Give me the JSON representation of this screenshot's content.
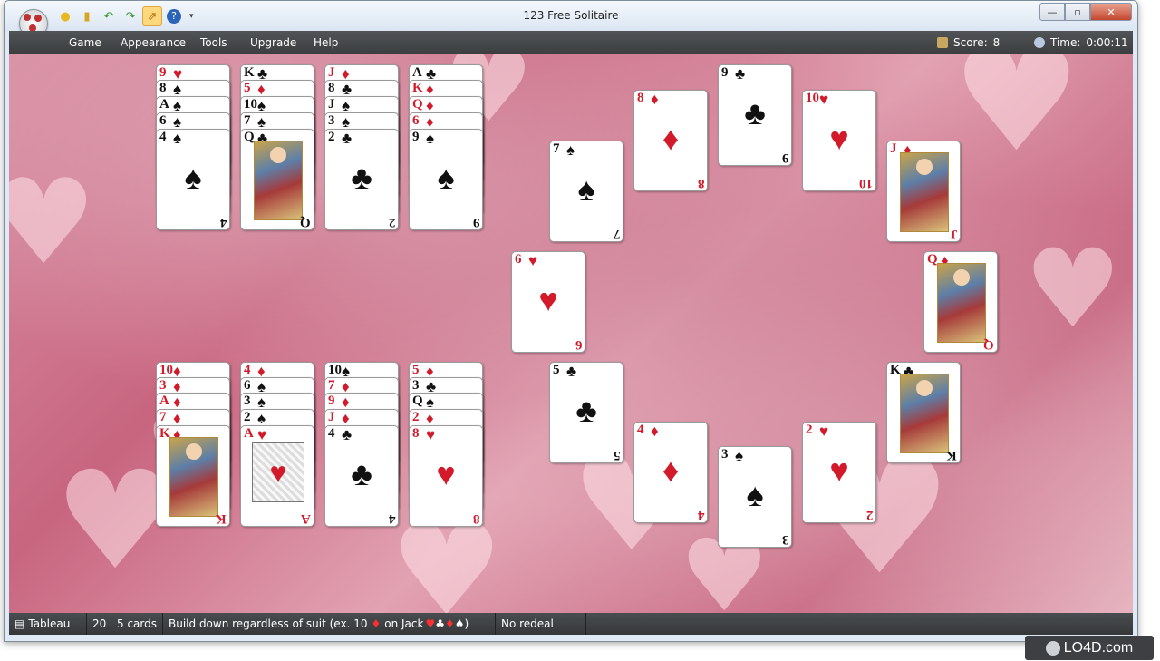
{
  "window": {
    "title": "123 Free Solitaire"
  },
  "menu": [
    "Game",
    "Appearance",
    "Tools",
    "Upgrade",
    "Help"
  ],
  "score": {
    "label": "Score:",
    "value": "8"
  },
  "time": {
    "label": "Time:",
    "value": "0:00:11"
  },
  "statusbar": {
    "mode": "Tableau",
    "count": "20",
    "cards": "5 cards",
    "hint_prefix": "Build down regardless of suit (ex. 10",
    "hint_mid": "on Jack",
    "hint_suffix": ")",
    "redeal": "No redeal"
  },
  "watermark": "LO4D.com",
  "cards": [
    {
      "rank": "9",
      "suit": "♥",
      "color": "red"
    },
    {
      "rank": "8",
      "suit": "♠",
      "color": "black"
    },
    {
      "rank": "A",
      "suit": "♠",
      "color": "black"
    },
    {
      "rank": "6",
      "suit": "♠",
      "color": "black"
    },
    {
      "rank": "4",
      "suit": "♠",
      "color": "black"
    },
    {
      "rank": "K",
      "suit": "♣",
      "color": "black"
    },
    {
      "rank": "5",
      "suit": "♦",
      "color": "red"
    },
    {
      "rank": "10",
      "suit": "♠",
      "color": "black"
    },
    {
      "rank": "7",
      "suit": "♠",
      "color": "black"
    },
    {
      "rank": "Q",
      "suit": "♣",
      "color": "black"
    },
    {
      "rank": "J",
      "suit": "♦",
      "color": "red"
    },
    {
      "rank": "8",
      "suit": "♣",
      "color": "black"
    },
    {
      "rank": "J",
      "suit": "♠",
      "color": "black"
    },
    {
      "rank": "3",
      "suit": "♠",
      "color": "black"
    },
    {
      "rank": "2",
      "suit": "♣",
      "color": "black"
    },
    {
      "rank": "A",
      "suit": "♣",
      "color": "black"
    },
    {
      "rank": "K",
      "suit": "♦",
      "color": "red"
    },
    {
      "rank": "Q",
      "suit": "♦",
      "color": "red"
    },
    {
      "rank": "6",
      "suit": "♦",
      "color": "red"
    },
    {
      "rank": "9",
      "suit": "♠",
      "color": "black"
    },
    {
      "rank": "10",
      "suit": "♦",
      "color": "red"
    },
    {
      "rank": "3",
      "suit": "♦",
      "color": "red"
    },
    {
      "rank": "A",
      "suit": "♦",
      "color": "red"
    },
    {
      "rank": "7",
      "suit": "♦",
      "color": "red"
    },
    {
      "rank": "K",
      "suit": "♦",
      "color": "red"
    },
    {
      "rank": "4",
      "suit": "♦",
      "color": "red"
    },
    {
      "rank": "6",
      "suit": "♠",
      "color": "black"
    },
    {
      "rank": "3",
      "suit": "♠",
      "color": "black"
    },
    {
      "rank": "2",
      "suit": "♠",
      "color": "black"
    },
    {
      "rank": "A",
      "suit": "♥",
      "color": "red"
    },
    {
      "rank": "10",
      "suit": "♠",
      "color": "black"
    },
    {
      "rank": "7",
      "suit": "♦",
      "color": "red"
    },
    {
      "rank": "9",
      "suit": "♦",
      "color": "red"
    },
    {
      "rank": "J",
      "suit": "♦",
      "color": "red"
    },
    {
      "rank": "4",
      "suit": "♣",
      "color": "black"
    },
    {
      "rank": "5",
      "suit": "♦",
      "color": "red"
    },
    {
      "rank": "3",
      "suit": "♣",
      "color": "black"
    },
    {
      "rank": "Q",
      "suit": "♠",
      "color": "black"
    },
    {
      "rank": "2",
      "suit": "♦",
      "color": "red"
    },
    {
      "rank": "8",
      "suit": "♥",
      "color": "red"
    },
    {
      "rank": "7",
      "suit": "♠",
      "color": "black"
    },
    {
      "rank": "8",
      "suit": "♦",
      "color": "red"
    },
    {
      "rank": "9",
      "suit": "♣",
      "color": "black"
    },
    {
      "rank": "10",
      "suit": "♥",
      "color": "red"
    },
    {
      "rank": "J",
      "suit": "♦",
      "color": "red"
    },
    {
      "rank": "6",
      "suit": "♥",
      "color": "red"
    },
    {
      "rank": "Q",
      "suit": "♦",
      "color": "red"
    },
    {
      "rank": "5",
      "suit": "♣",
      "color": "black"
    },
    {
      "rank": "K",
      "suit": "♣",
      "color": "black"
    },
    {
      "rank": "4",
      "suit": "♦",
      "color": "red"
    },
    {
      "rank": "3",
      "suit": "♠",
      "color": "black"
    },
    {
      "rank": "2",
      "suit": "♥",
      "color": "red"
    }
  ]
}
